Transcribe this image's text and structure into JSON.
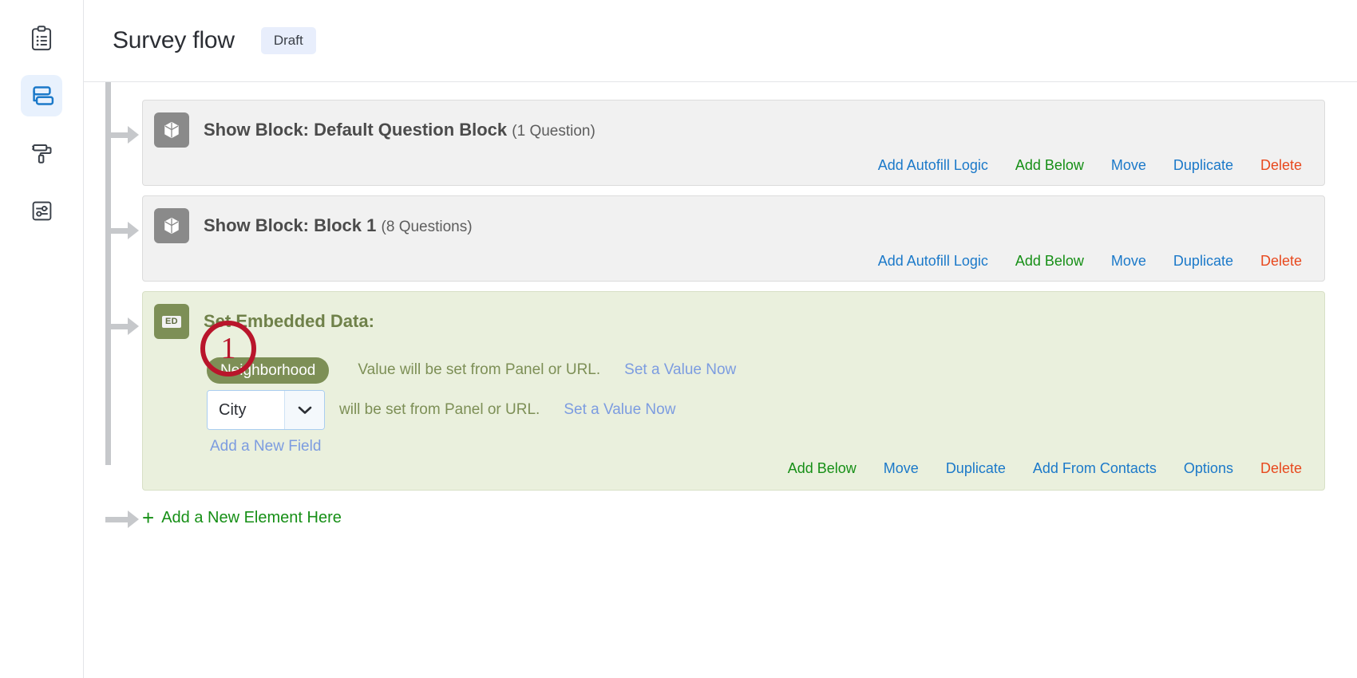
{
  "sidebar": {
    "items": [
      {
        "name": "survey-builder",
        "icon": "clipboard-list-icon",
        "active": false
      },
      {
        "name": "survey-flow",
        "icon": "flow-blocks-icon",
        "active": true
      },
      {
        "name": "look-and-feel",
        "icon": "paint-roller-icon",
        "active": false
      },
      {
        "name": "survey-options",
        "icon": "sliders-icon",
        "active": false
      }
    ]
  },
  "header": {
    "title": "Survey flow",
    "status": "Draft"
  },
  "flow": {
    "elements": [
      {
        "kind": "block",
        "icon": "cube-icon",
        "title": "Show Block: Default Question Block",
        "count": "(1 Question)",
        "actions": [
          {
            "label": "Add Autofill Logic",
            "color": "blue"
          },
          {
            "label": "Add Below",
            "color": "green"
          },
          {
            "label": "Move",
            "color": "blue"
          },
          {
            "label": "Duplicate",
            "color": "blue"
          },
          {
            "label": "Delete",
            "color": "red"
          }
        ]
      },
      {
        "kind": "block",
        "icon": "cube-icon",
        "title": "Show Block: Block 1",
        "count": "(8 Questions)",
        "actions": [
          {
            "label": "Add Autofill Logic",
            "color": "blue"
          },
          {
            "label": "Add Below",
            "color": "green"
          },
          {
            "label": "Move",
            "color": "blue"
          },
          {
            "label": "Duplicate",
            "color": "blue"
          },
          {
            "label": "Delete",
            "color": "red"
          }
        ]
      },
      {
        "kind": "embedded-data",
        "icon": "ed-icon",
        "icon_label": "ED",
        "title": "Set Embedded Data:",
        "fields": [
          {
            "type": "pill",
            "name": "Neighborhood",
            "note": "Value will be set from Panel or URL.",
            "set_value_label": "Set a Value Now"
          },
          {
            "type": "select",
            "value": "City",
            "note": "will be set from Panel or URL.",
            "set_value_label": "Set a Value Now"
          }
        ],
        "add_field_label": "Add a New Field",
        "actions": [
          {
            "label": "Add Below",
            "color": "green"
          },
          {
            "label": "Move",
            "color": "blue"
          },
          {
            "label": "Duplicate",
            "color": "blue"
          },
          {
            "label": "Add From Contacts",
            "color": "blue"
          },
          {
            "label": "Options",
            "color": "blue"
          },
          {
            "label": "Delete",
            "color": "red"
          }
        ]
      }
    ],
    "add_element_label": "Add a New Element Here",
    "add_element_plus": "+"
  },
  "annotations": [
    {
      "label": "1",
      "target": "embedded-data-field-select"
    }
  ],
  "colors": {
    "link_blue": "#1b79c9",
    "link_green": "#168f16",
    "link_red": "#e8491e",
    "link_lightblue": "#7c9ce0",
    "embedded_green": "#7d8f56",
    "embedded_bg": "#eaf0dd",
    "block_bg": "#f1f1f1",
    "annotation_red": "#b9152b",
    "active_sidebar": "#1b79c9"
  }
}
